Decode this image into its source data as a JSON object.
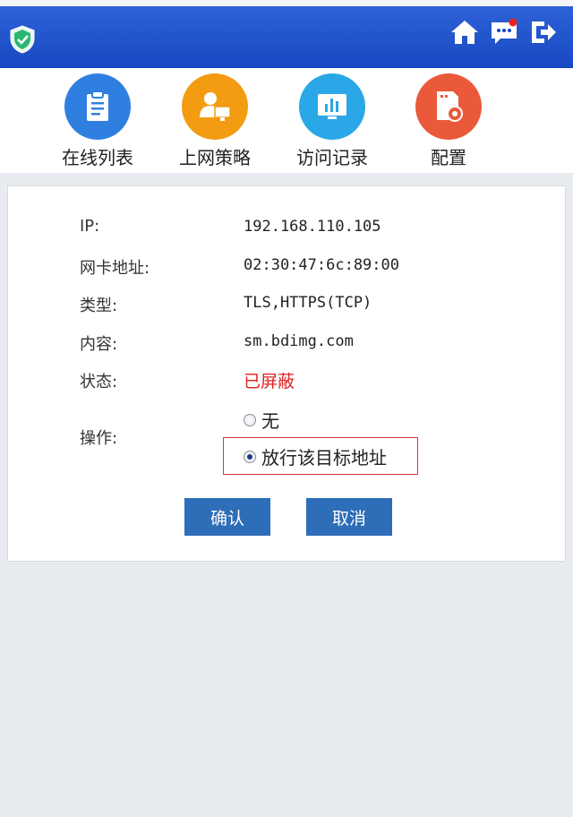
{
  "header": {
    "logo_icon": "shield-icon",
    "actions": [
      {
        "icon": "home-icon"
      },
      {
        "icon": "message-icon"
      },
      {
        "icon": "logout-icon"
      }
    ]
  },
  "nav": {
    "items": [
      {
        "label": "在线列表",
        "icon": "clipboard-icon",
        "color": "#2f7fe0"
      },
      {
        "label": "上网策略",
        "icon": "user-monitor-icon",
        "color": "#f39c12"
      },
      {
        "label": "访问记录",
        "icon": "chart-icon",
        "color": "#2aa7e6"
      },
      {
        "label": "配置",
        "icon": "gear-file-icon",
        "color": "#ea5a3a"
      }
    ]
  },
  "detail": {
    "ip_label": "IP:",
    "ip_value": "192.168.110.105",
    "mac_label": "网卡地址:",
    "mac_value": "02:30:47:6c:89:00",
    "type_label": "类型:",
    "type_value": "TLS,HTTPS(TCP)",
    "content_label": "内容:",
    "content_value": "sm.bdimg.com",
    "status_label": "状态:",
    "status_value": "已屏蔽",
    "status_color": "#e02020",
    "action_label": "操作:",
    "options": [
      {
        "label": "无",
        "checked": false
      },
      {
        "label": "放行该目标地址",
        "checked": true
      }
    ]
  },
  "buttons": {
    "confirm": "确认",
    "cancel": "取消"
  }
}
